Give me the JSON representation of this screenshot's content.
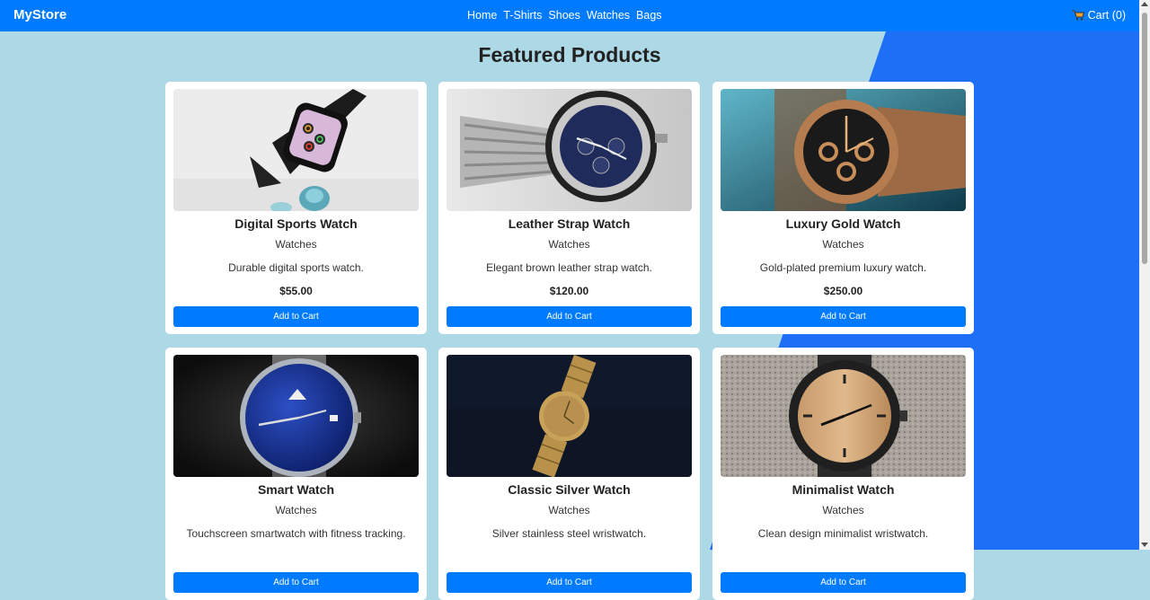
{
  "navbar": {
    "brand": "MyStore",
    "links": [
      "Home",
      "T-Shirts",
      "Shoes",
      "Watches",
      "Bags"
    ],
    "cart_label": "Cart (0)"
  },
  "page_title": "Featured Products",
  "products": [
    {
      "name": "Digital Sports Watch",
      "category": "Watches",
      "description": "Durable digital sports watch.",
      "price": "$55.00",
      "button": "Add to Cart",
      "image_icon": "smartwatch-photo"
    },
    {
      "name": "Leather Strap Watch",
      "category": "Watches",
      "description": "Elegant brown leather strap watch.",
      "price": "$120.00",
      "button": "Add to Cart",
      "image_icon": "steel-chronograph-photo"
    },
    {
      "name": "Luxury Gold Watch",
      "category": "Watches",
      "description": "Gold-plated premium luxury watch.",
      "price": "$250.00",
      "button": "Add to Cart",
      "image_icon": "gold-watch-photo"
    },
    {
      "name": "Smart Watch",
      "category": "Watches",
      "description": "Touchscreen smartwatch with fitness tracking.",
      "price": "",
      "button": "Add to Cart",
      "image_icon": "blue-dial-watch-photo"
    },
    {
      "name": "Classic Silver Watch",
      "category": "Watches",
      "description": "Silver stainless steel wristwatch.",
      "price": "",
      "button": "Add to Cart",
      "image_icon": "gold-bracelet-watch-photo"
    },
    {
      "name": "Minimalist Watch",
      "category": "Watches",
      "description": "Clean design minimalist wristwatch.",
      "price": "",
      "button": "Add to Cart",
      "image_icon": "wooden-dial-watch-photo"
    }
  ],
  "colors": {
    "nav": "#007bff",
    "bg_light": "#add8e6",
    "bg_accent": "#1e6ff5",
    "button": "#007bff"
  }
}
